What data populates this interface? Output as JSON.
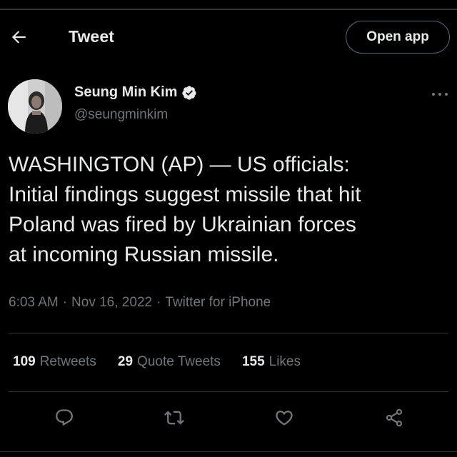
{
  "header": {
    "title": "Tweet",
    "open_app_label": "Open app",
    "back_icon": "arrow-left-icon"
  },
  "author": {
    "name": "Seung Min Kim",
    "handle": "@seungminkim",
    "verified": true,
    "verified_icon": "verified-badge-icon"
  },
  "tweet": {
    "text": "WASHINGTON (AP) — US officials:\nInitial findings suggest missile that hit\nPoland was fired by Ukrainian forces\nat incoming Russian missile.",
    "time": "6:03 AM",
    "date": "Nov 16, 2022",
    "source": "Twitter for iPhone",
    "separator": "·"
  },
  "stats": {
    "retweets": {
      "count": "109",
      "label": "Retweets"
    },
    "quote_tweets": {
      "count": "29",
      "label": "Quote Tweets"
    },
    "likes": {
      "count": "155",
      "label": "Likes"
    }
  },
  "actions": [
    "reply-icon",
    "retweet-icon",
    "like-icon",
    "share-icon"
  ],
  "colors": {
    "background": "#000000",
    "primary_text": "#e7e9ea",
    "secondary_text": "#71767b",
    "divider": "#2f3336"
  }
}
